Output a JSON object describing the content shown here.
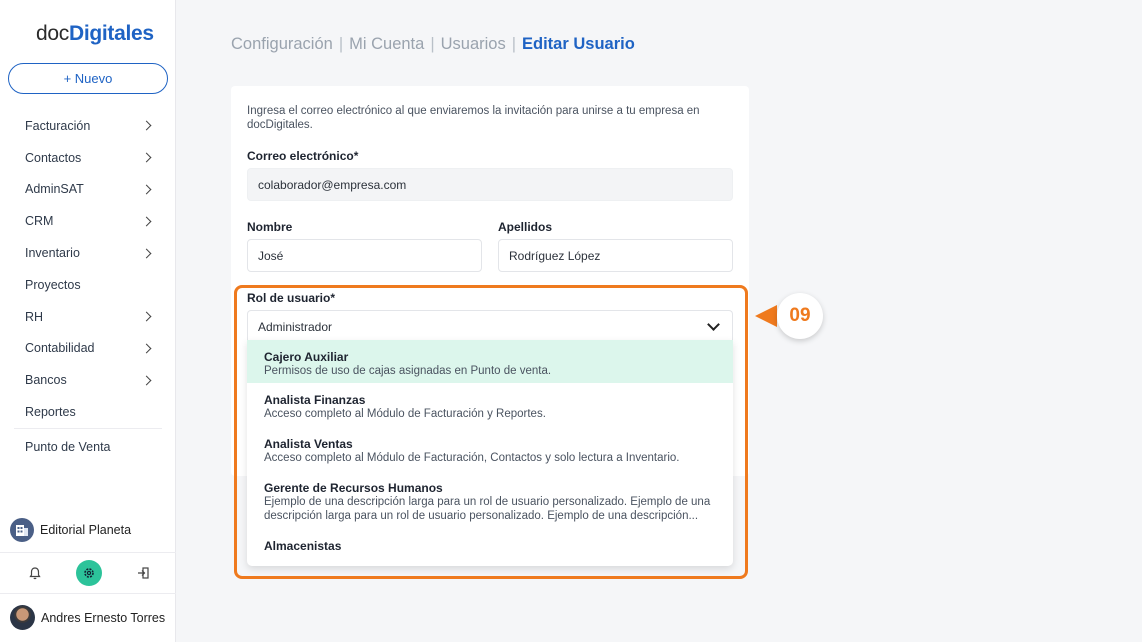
{
  "logo": {
    "part1": "doc",
    "part2": "Digitales"
  },
  "new_button": "+ Nuevo",
  "sidebar": {
    "items": [
      {
        "label": "Facturación",
        "has_children": true
      },
      {
        "label": "Contactos",
        "has_children": true
      },
      {
        "label": "AdminSAT",
        "has_children": true
      },
      {
        "label": "CRM",
        "has_children": true
      },
      {
        "label": "Inventario",
        "has_children": true
      },
      {
        "label": "Proyectos",
        "has_children": false
      },
      {
        "label": "RH",
        "has_children": true
      },
      {
        "label": "Contabilidad",
        "has_children": true
      },
      {
        "label": "Bancos",
        "has_children": true
      },
      {
        "label": "Reportes",
        "has_children": false
      }
    ],
    "extra_item": "Punto de Venta",
    "company": "Editorial Planeta",
    "user": "Andres Ernesto Torres"
  },
  "breadcrumb": {
    "items": [
      "Configuración",
      "Mi Cuenta",
      "Usuarios"
    ],
    "current": "Editar Usuario",
    "separator": "|"
  },
  "form": {
    "intro": "Ingresa el correo electrónico al que enviaremos la invitación para unirse a tu empresa en docDigitales.",
    "email_label": "Correo electrónico*",
    "email_value": "colaborador@empresa.com",
    "name_label": "Nombre",
    "name_value": "José",
    "lastname_label": "Apellidos",
    "lastname_value": "Rodríguez López",
    "role_label": "Rol de usuario*",
    "role_value": "Administrador"
  },
  "dropdown": {
    "options": [
      {
        "title": "Cajero Auxiliar",
        "desc": "Permisos de uso de cajas asignadas en Punto de venta.",
        "selected": true
      },
      {
        "title": "Analista Finanzas",
        "desc": "Acceso completo al Módulo de Facturación y Reportes.",
        "selected": false
      },
      {
        "title": "Analista Ventas",
        "desc": "Acceso completo al Módulo de Facturación, Contactos y solo lectura a Inventario.",
        "selected": false
      },
      {
        "title": "Gerente de Recursos Humanos",
        "desc": "Ejemplo de una descripción larga para un rol de usuario personalizado. Ejemplo de una descripción larga para un rol de usuario personalizado. Ejemplo de una descripción...",
        "selected": false
      },
      {
        "title": "Almacenistas",
        "desc": "",
        "selected": false
      }
    ]
  },
  "callout": {
    "number": "09"
  },
  "colors": {
    "brand": "#1f63c4",
    "accent": "#ef7a1e",
    "selected_bg": "#dcf6ec",
    "gear_bg": "#2cc39a"
  }
}
